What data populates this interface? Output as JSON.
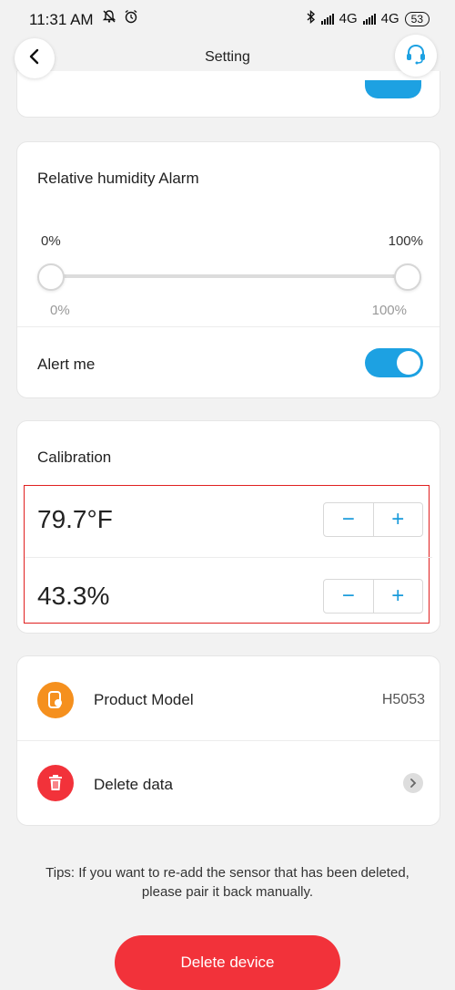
{
  "status_bar": {
    "time": "11:31 AM",
    "left_icons": [
      "muted-bell-icon",
      "alarm-clock-icon"
    ],
    "network_1": "4G",
    "network_2": "4G",
    "battery": "53"
  },
  "header": {
    "title": "Setting",
    "back_icon": "chevron-left-icon",
    "support_icon": "headset-icon"
  },
  "humidity_alarm": {
    "title": "Relative humidity Alarm",
    "range_min_label": "0%",
    "range_max_label": "100%",
    "slider_min_label": "0%",
    "slider_max_label": "100%",
    "slider_low_value": 0,
    "slider_high_value": 100,
    "alert_label": "Alert me",
    "alert_enabled": true
  },
  "calibration": {
    "title": "Calibration",
    "temperature": "79.7°F",
    "humidity": "43.3%",
    "minus_symbol": "−",
    "plus_symbol": "+"
  },
  "info": {
    "product_model_label": "Product Model",
    "product_model_value": "H5053",
    "delete_data_label": "Delete data"
  },
  "tips": "Tips: If you want to re-add the sensor that has been deleted, please pair it back manually.",
  "delete_device_label": "Delete device",
  "colors": {
    "accent": "#1da1e2",
    "danger": "#f2323a",
    "orange": "#f5901e",
    "highlight": "#e02020"
  }
}
